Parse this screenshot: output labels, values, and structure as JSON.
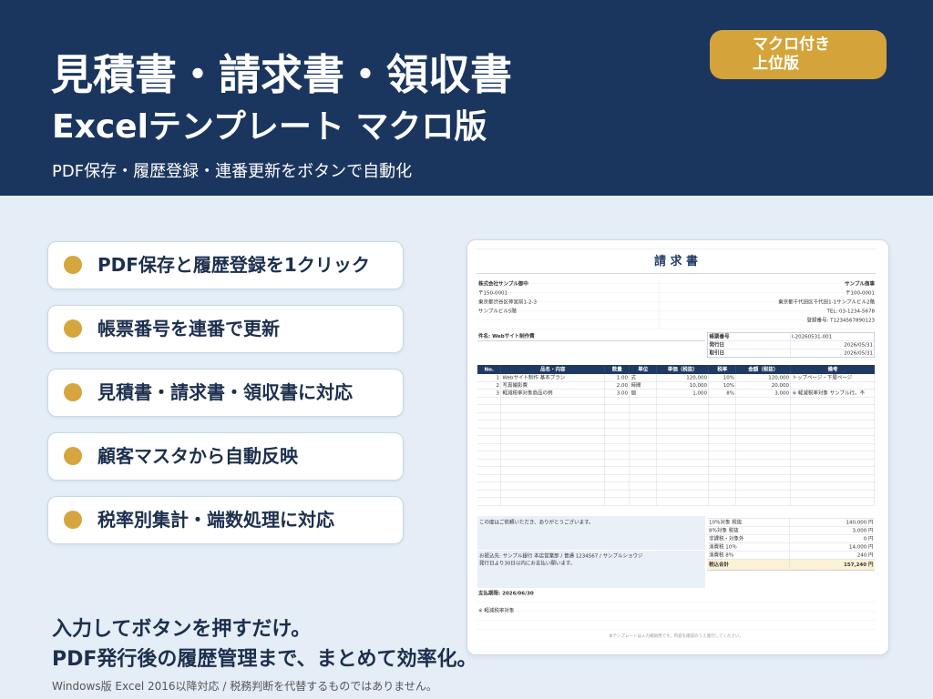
{
  "header": {
    "title": "見積書・請求書・領収書",
    "subtitle": "Excelテンプレート マクロ版",
    "tagline": "PDF保存・履歴登録・連番更新をボタンで自動化"
  },
  "badge": {
    "line1": "マクロ付き",
    "line2": "上位版"
  },
  "features": [
    {
      "label": "PDF保存と履歴登録を1クリック"
    },
    {
      "label": "帳票番号を連番で更新"
    },
    {
      "label": "見積書・請求書・領収書に対応"
    },
    {
      "label": "顧客マスタから自動反映"
    },
    {
      "label": "税率別集計・端数処理に対応"
    }
  ],
  "footer": {
    "line1": "入力してボタンを押すだけ。",
    "line2": "PDF発行後の履歴管理まで、まとめて効率化。",
    "note": "Windows版 Excel 2016以降対応 / 税務判断を代替するものではありません。"
  },
  "invoice": {
    "title": "請 求 書",
    "customer": {
      "name": "株式会社サンプル御中",
      "zip": "〒150-0001",
      "address": "東京都渋谷区神宮前1-2-3",
      "building": "サンプルビル5階"
    },
    "issuer": {
      "name": "サンプル商事",
      "zip": "〒100-0001",
      "address": "東京都千代田区千代田1-1サンプルビル2階",
      "tel": "TEL: 03-1234-5678",
      "registration": "登録番号: T1234567890123"
    },
    "subject": "件名: Webサイト制作費",
    "meta": [
      {
        "label": "帳票番号",
        "value": "I-20260531-001"
      },
      {
        "label": "発行日",
        "value": "2026/05/31"
      },
      {
        "label": "取引日",
        "value": "2026/05/31"
      }
    ],
    "columns": [
      "No.",
      "品名・内容",
      "数量",
      "単位",
      "単価（税抜）",
      "税率",
      "金額（税抜）",
      "備考"
    ],
    "items": [
      {
        "no": "1",
        "name": "Webサイト制作 基本プラン",
        "qty": "1.00",
        "unit": "式",
        "price": "120,000",
        "rate": "10%",
        "amount": "120,000",
        "note": "トップページ・下層ページ"
      },
      {
        "no": "2",
        "name": "写真撮影費",
        "qty": "2.00",
        "unit": "時間",
        "price": "10,000",
        "rate": "10%",
        "amount": "20,000"
      },
      {
        "no": "3",
        "name": "軽減税率対象商品の例",
        "qty": "3.00",
        "unit": "個",
        "price": "1,000",
        "rate": "8%",
        "amount": "3,000",
        "note": "※ 軽減税率対象 サンプル行。不"
      }
    ],
    "message": "この度はご依頼いただき、ありがとうございます。",
    "bank": "お振込先: サンプル銀行 本店営業部 / 普通 1234567 / サンプルショウジ",
    "payment_note": "発行日より30日以内にお支払い願います。",
    "summary": [
      {
        "label": "10％対象 税抜",
        "value": "140,000 円"
      },
      {
        "label": "8％対象 税抜",
        "value": "3,000 円"
      },
      {
        "label": "非課税・対象外",
        "value": "0 円"
      },
      {
        "label": "消費税 10％",
        "value": "14,000 円"
      },
      {
        "label": "消費税 8％",
        "value": "240 円"
      },
      {
        "label": "税込合計",
        "value": "157,240 円"
      }
    ],
    "due": "支払期限: 2026/06/30",
    "reduced_note": "※ 軽減税率対象",
    "footer_note": "本テンプレートは入力補助用です。内容を確認のうえ発行してください。"
  },
  "colors": {
    "navy": "#1b365e",
    "gold": "#d4a43a",
    "background": "#e5edf7",
    "table_header": "#1f3b63",
    "total_highlight": "#fbf1d6"
  }
}
